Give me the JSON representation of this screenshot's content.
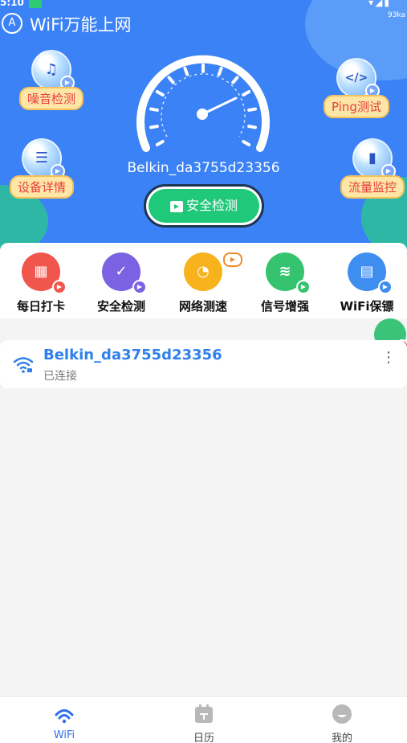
{
  "status_bar": {
    "time": "5:10",
    "icons": "▾◢▮",
    "net_speed": "93ka"
  },
  "app": {
    "logo_icon": "A",
    "title": "WiFi万能上网"
  },
  "tools": {
    "noise": {
      "label": "噪音检测",
      "icon": "music-note-icon",
      "glyph": "♫"
    },
    "ping": {
      "label": "Ping测试",
      "icon": "code-icon",
      "glyph": "</>"
    },
    "device": {
      "label": "设备详情",
      "icon": "server-icon",
      "glyph": "☰"
    },
    "traffic": {
      "label": "流量监控",
      "icon": "phone-pulse-icon",
      "glyph": "▮"
    }
  },
  "hero": {
    "ssid": "Belkin_da3755d23356",
    "scan_button": "安全检测"
  },
  "quick": [
    {
      "label": "每日打卡",
      "color": "#f0564c",
      "play_color": "#f0564c",
      "glyph": "▦"
    },
    {
      "label": "安全检测",
      "color": "#7a62e3",
      "play_color": "#7a62e3",
      "glyph": "✓"
    },
    {
      "label": "网络测速",
      "color": "#f8b21c",
      "play_color": "#f08a2a",
      "glyph": "◔"
    },
    {
      "label": "信号增强",
      "color": "#36c36f",
      "play_color": "#36c36f",
      "glyph": "≋"
    },
    {
      "label": "WiFi保镖",
      "color": "#3e8ef0",
      "play_color": "#3e8ef0",
      "glyph": "▤"
    }
  ],
  "connection": {
    "ssid": "Belkin_da3755d23356",
    "status": "已连接",
    "more": "⋮"
  },
  "tabs": [
    {
      "label": "WiFi",
      "active": true
    },
    {
      "label": "日历",
      "active": false
    },
    {
      "label": "我的",
      "active": false
    }
  ],
  "colors": {
    "primary": "#3b82f6",
    "accent_green": "#20c97a",
    "link_blue": "#2f80ed"
  }
}
